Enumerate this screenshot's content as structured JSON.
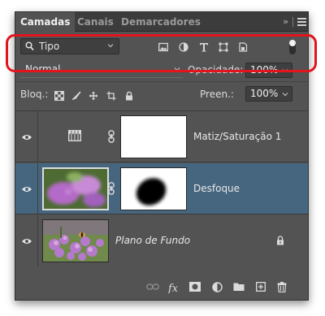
{
  "tabs": [
    {
      "label": "Camadas",
      "active": true
    },
    {
      "label": "Canais",
      "active": false
    },
    {
      "label": "Demarcadores",
      "active": false
    }
  ],
  "tab_bar": {
    "collapse_label": "»",
    "menu_icon": "hamburger-menu-icon"
  },
  "filter": {
    "kind_value": "Tipo",
    "icons": [
      "pixel-layer-filter-icon",
      "adjustment-layer-filter-icon",
      "type-layer-filter-icon",
      "shape-layer-filter-icon",
      "smart-object-filter-icon"
    ],
    "toggle_on": true
  },
  "blend": {
    "mode": "Normal",
    "opacity_label": "Opacidade:",
    "opacity_value": "100%"
  },
  "lock": {
    "label": "Bloq.:",
    "icons": [
      "lock-transparent-pixels-icon",
      "lock-image-pixels-icon",
      "lock-position-icon",
      "lock-artboard-icon",
      "lock-all-icon"
    ],
    "fill_label": "Preen.:",
    "fill_value": "100%"
  },
  "layers": [
    {
      "name": "Matiz/Saturação 1",
      "type": "adjustment",
      "selected": false,
      "visible": true,
      "italic": false
    },
    {
      "name": "Desfoque",
      "type": "pixel-with-mask",
      "selected": true,
      "visible": true,
      "italic": false
    },
    {
      "name": "Plano de Fundo",
      "type": "background",
      "selected": false,
      "visible": true,
      "italic": true,
      "locked": true
    }
  ],
  "footer_icons": [
    "link-layers-icon",
    "fx-icon",
    "add-mask-icon",
    "new-adjustment-icon",
    "new-group-icon",
    "new-layer-icon",
    "delete-layer-icon"
  ],
  "colors": {
    "panel": "#535353",
    "tab_bar": "#3c3c3c",
    "selected_layer": "#46667f",
    "highlight": "#e3141b"
  }
}
